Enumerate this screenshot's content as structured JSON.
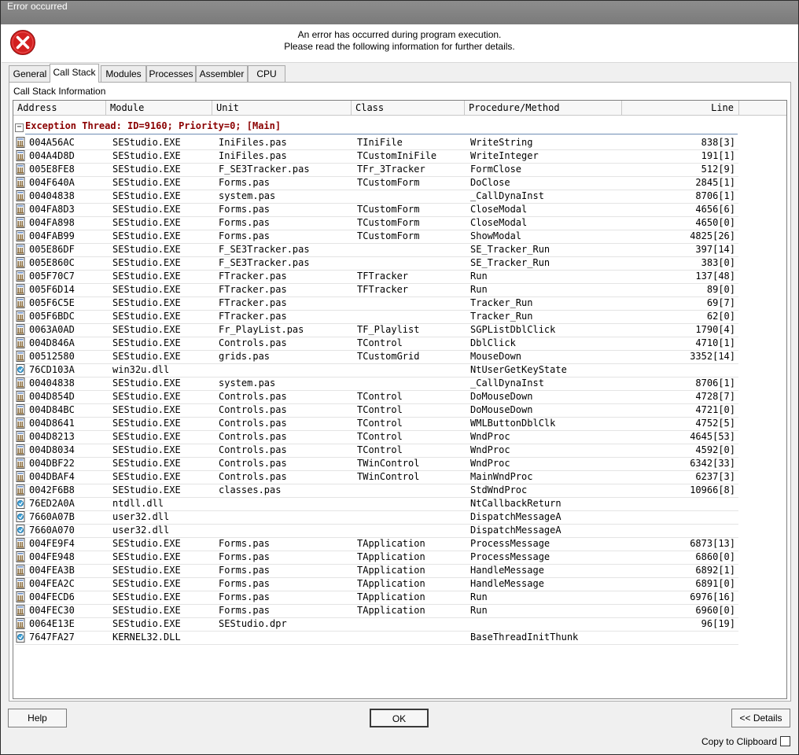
{
  "window": {
    "title": "Error occurred"
  },
  "header": {
    "line1": "An error has occurred during program execution.",
    "line2": "Please read the following information for further details."
  },
  "tabs": [
    "General",
    "Call Stack",
    "Modules",
    "Processes",
    "Assembler",
    "CPU"
  ],
  "active_tab": "Call Stack",
  "panel_title": "Call Stack Information",
  "columns": [
    "Address",
    "Module",
    "Unit",
    "Class",
    "Procedure/Method",
    "Line"
  ],
  "thread_label": "Exception Thread: ID=9160; Priority=0; [Main]",
  "expand_glyph": "−",
  "rows": [
    {
      "addr": "004A56AC",
      "mod": "SEStudio.EXE",
      "unit": "IniFiles.pas",
      "cls": "TIniFile",
      "proc": "WriteString",
      "line": "838[3]",
      "icon": "module-icon"
    },
    {
      "addr": "004A4D8D",
      "mod": "SEStudio.EXE",
      "unit": "IniFiles.pas",
      "cls": "TCustomIniFile",
      "proc": "WriteInteger",
      "line": "191[1]",
      "icon": "module-icon"
    },
    {
      "addr": "005E8FE8",
      "mod": "SEStudio.EXE",
      "unit": "F_SE3Tracker.pas",
      "cls": "TFr_3Tracker",
      "proc": "FormClose",
      "line": "512[9]",
      "icon": "module-icon"
    },
    {
      "addr": "004F640A",
      "mod": "SEStudio.EXE",
      "unit": "Forms.pas",
      "cls": "TCustomForm",
      "proc": "DoClose",
      "line": "2845[1]",
      "icon": "module-icon"
    },
    {
      "addr": "00404838",
      "mod": "SEStudio.EXE",
      "unit": "system.pas",
      "cls": "",
      "proc": "_CallDynaInst",
      "line": "8706[1]",
      "icon": "module-icon"
    },
    {
      "addr": "004FA8D3",
      "mod": "SEStudio.EXE",
      "unit": "Forms.pas",
      "cls": "TCustomForm",
      "proc": "CloseModal",
      "line": "4656[6]",
      "icon": "module-icon"
    },
    {
      "addr": "004FA898",
      "mod": "SEStudio.EXE",
      "unit": "Forms.pas",
      "cls": "TCustomForm",
      "proc": "CloseModal",
      "line": "4650[0]",
      "icon": "module-icon"
    },
    {
      "addr": "004FAB99",
      "mod": "SEStudio.EXE",
      "unit": "Forms.pas",
      "cls": "TCustomForm",
      "proc": "ShowModal",
      "line": "4825[26]",
      "icon": "module-icon"
    },
    {
      "addr": "005E86DF",
      "mod": "SEStudio.EXE",
      "unit": "F_SE3Tracker.pas",
      "cls": "",
      "proc": "SE_Tracker_Run",
      "line": "397[14]",
      "icon": "module-icon"
    },
    {
      "addr": "005E860C",
      "mod": "SEStudio.EXE",
      "unit": "F_SE3Tracker.pas",
      "cls": "",
      "proc": "SE_Tracker_Run",
      "line": "383[0]",
      "icon": "module-icon"
    },
    {
      "addr": "005F70C7",
      "mod": "SEStudio.EXE",
      "unit": "FTracker.pas",
      "cls": "TFTracker",
      "proc": "Run",
      "line": "137[48]",
      "icon": "module-icon"
    },
    {
      "addr": "005F6D14",
      "mod": "SEStudio.EXE",
      "unit": "FTracker.pas",
      "cls": "TFTracker",
      "proc": "Run",
      "line": "89[0]",
      "icon": "module-icon"
    },
    {
      "addr": "005F6C5E",
      "mod": "SEStudio.EXE",
      "unit": "FTracker.pas",
      "cls": "",
      "proc": "Tracker_Run",
      "line": "69[7]",
      "icon": "module-icon"
    },
    {
      "addr": "005F6BDC",
      "mod": "SEStudio.EXE",
      "unit": "FTracker.pas",
      "cls": "",
      "proc": "Tracker_Run",
      "line": "62[0]",
      "icon": "module-icon"
    },
    {
      "addr": "0063A0AD",
      "mod": "SEStudio.EXE",
      "unit": "Fr_PlayList.pas",
      "cls": "TF_Playlist",
      "proc": "SGPListDblClick",
      "line": "1790[4]",
      "icon": "module-icon"
    },
    {
      "addr": "004D846A",
      "mod": "SEStudio.EXE",
      "unit": "Controls.pas",
      "cls": "TControl",
      "proc": "DblClick",
      "line": "4710[1]",
      "icon": "module-icon"
    },
    {
      "addr": "00512580",
      "mod": "SEStudio.EXE",
      "unit": "grids.pas",
      "cls": "TCustomGrid",
      "proc": "MouseDown",
      "line": "3352[14]",
      "icon": "module-icon"
    },
    {
      "addr": "76CD103A",
      "mod": "win32u.dll",
      "unit": "",
      "cls": "",
      "proc": "NtUserGetKeyState",
      "line": "",
      "icon": "dll-icon"
    },
    {
      "addr": "00404838",
      "mod": "SEStudio.EXE",
      "unit": "system.pas",
      "cls": "",
      "proc": "_CallDynaInst",
      "line": "8706[1]",
      "icon": "module-icon"
    },
    {
      "addr": "004D854D",
      "mod": "SEStudio.EXE",
      "unit": "Controls.pas",
      "cls": "TControl",
      "proc": "DoMouseDown",
      "line": "4728[7]",
      "icon": "module-icon"
    },
    {
      "addr": "004D84BC",
      "mod": "SEStudio.EXE",
      "unit": "Controls.pas",
      "cls": "TControl",
      "proc": "DoMouseDown",
      "line": "4721[0]",
      "icon": "module-icon"
    },
    {
      "addr": "004D8641",
      "mod": "SEStudio.EXE",
      "unit": "Controls.pas",
      "cls": "TControl",
      "proc": "WMLButtonDblClk",
      "line": "4752[5]",
      "icon": "module-icon"
    },
    {
      "addr": "004D8213",
      "mod": "SEStudio.EXE",
      "unit": "Controls.pas",
      "cls": "TControl",
      "proc": "WndProc",
      "line": "4645[53]",
      "icon": "module-icon"
    },
    {
      "addr": "004D8034",
      "mod": "SEStudio.EXE",
      "unit": "Controls.pas",
      "cls": "TControl",
      "proc": "WndProc",
      "line": "4592[0]",
      "icon": "module-icon"
    },
    {
      "addr": "004DBF22",
      "mod": "SEStudio.EXE",
      "unit": "Controls.pas",
      "cls": "TWinControl",
      "proc": "WndProc",
      "line": "6342[33]",
      "icon": "module-icon"
    },
    {
      "addr": "004DBAF4",
      "mod": "SEStudio.EXE",
      "unit": "Controls.pas",
      "cls": "TWinControl",
      "proc": "MainWndProc",
      "line": "6237[3]",
      "icon": "module-icon"
    },
    {
      "addr": "0042F6B8",
      "mod": "SEStudio.EXE",
      "unit": "classes.pas",
      "cls": "",
      "proc": "StdWndProc",
      "line": "10966[8]",
      "icon": "module-icon"
    },
    {
      "addr": "76ED2A0A",
      "mod": "ntdll.dll",
      "unit": "",
      "cls": "",
      "proc": "NtCallbackReturn",
      "line": "",
      "icon": "dll-icon"
    },
    {
      "addr": "7660A07B",
      "mod": "user32.dll",
      "unit": "",
      "cls": "",
      "proc": "DispatchMessageA",
      "line": "",
      "icon": "dll-icon"
    },
    {
      "addr": "7660A070",
      "mod": "user32.dll",
      "unit": "",
      "cls": "",
      "proc": "DispatchMessageA",
      "line": "",
      "icon": "dll-icon"
    },
    {
      "addr": "004FE9F4",
      "mod": "SEStudio.EXE",
      "unit": "Forms.pas",
      "cls": "TApplication",
      "proc": "ProcessMessage",
      "line": "6873[13]",
      "icon": "module-icon"
    },
    {
      "addr": "004FE948",
      "mod": "SEStudio.EXE",
      "unit": "Forms.pas",
      "cls": "TApplication",
      "proc": "ProcessMessage",
      "line": "6860[0]",
      "icon": "module-icon"
    },
    {
      "addr": "004FEA3B",
      "mod": "SEStudio.EXE",
      "unit": "Forms.pas",
      "cls": "TApplication",
      "proc": "HandleMessage",
      "line": "6892[1]",
      "icon": "module-icon"
    },
    {
      "addr": "004FEA2C",
      "mod": "SEStudio.EXE",
      "unit": "Forms.pas",
      "cls": "TApplication",
      "proc": "HandleMessage",
      "line": "6891[0]",
      "icon": "module-icon"
    },
    {
      "addr": "004FECD6",
      "mod": "SEStudio.EXE",
      "unit": "Forms.pas",
      "cls": "TApplication",
      "proc": "Run",
      "line": "6976[16]",
      "icon": "module-icon"
    },
    {
      "addr": "004FEC30",
      "mod": "SEStudio.EXE",
      "unit": "Forms.pas",
      "cls": "TApplication",
      "proc": "Run",
      "line": "6960[0]",
      "icon": "module-icon"
    },
    {
      "addr": "0064E13E",
      "mod": "SEStudio.EXE",
      "unit": "SEStudio.dpr",
      "cls": "",
      "proc": "",
      "line": "96[19]",
      "icon": "module-icon"
    },
    {
      "addr": "7647FA27",
      "mod": "KERNEL32.DLL",
      "unit": "",
      "cls": "",
      "proc": "BaseThreadInitThunk",
      "line": "",
      "icon": "dll-icon"
    }
  ],
  "buttons": {
    "help": "Help",
    "ok": "OK",
    "details": "<< Details"
  },
  "copy_to_clipboard": {
    "label": "Copy to Clipboard",
    "checked": false
  },
  "colors": {
    "error": "#d32020",
    "thread_text": "#8b0000",
    "title_bar": "#858585"
  },
  "icons": {
    "error": "error-x-icon",
    "module": "module-icon",
    "dll": "dll-icon",
    "expand": "collapse-box-icon"
  }
}
